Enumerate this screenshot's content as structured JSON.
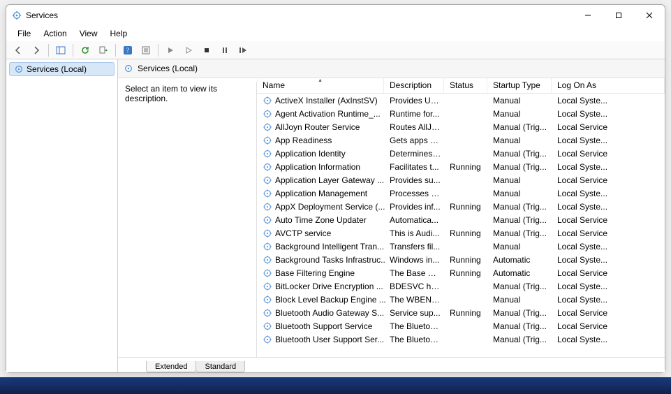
{
  "window": {
    "title": "Services"
  },
  "menubar": {
    "file": "File",
    "action": "Action",
    "view": "View",
    "help": "Help"
  },
  "nav": {
    "item0": "Services (Local)"
  },
  "content_header": {
    "title": "Services (Local)"
  },
  "detail": {
    "prompt": "Select an item to view its description."
  },
  "columns": {
    "name": "Name",
    "description": "Description",
    "status": "Status",
    "startup": "Startup Type",
    "logon": "Log On As"
  },
  "tabs": {
    "extended": "Extended",
    "standard": "Standard"
  },
  "rows": [
    {
      "name": "ActiveX Installer (AxInstSV)",
      "desc": "Provides Us...",
      "status": "",
      "startup": "Manual",
      "logon": "Local Syste..."
    },
    {
      "name": "Agent Activation Runtime_...",
      "desc": "Runtime for...",
      "status": "",
      "startup": "Manual",
      "logon": "Local Syste..."
    },
    {
      "name": "AllJoyn Router Service",
      "desc": "Routes AllJo...",
      "status": "",
      "startup": "Manual (Trig...",
      "logon": "Local Service"
    },
    {
      "name": "App Readiness",
      "desc": "Gets apps re...",
      "status": "",
      "startup": "Manual",
      "logon": "Local Syste..."
    },
    {
      "name": "Application Identity",
      "desc": "Determines ...",
      "status": "",
      "startup": "Manual (Trig...",
      "logon": "Local Service"
    },
    {
      "name": "Application Information",
      "desc": "Facilitates t...",
      "status": "Running",
      "startup": "Manual (Trig...",
      "logon": "Local Syste..."
    },
    {
      "name": "Application Layer Gateway ...",
      "desc": "Provides su...",
      "status": "",
      "startup": "Manual",
      "logon": "Local Service"
    },
    {
      "name": "Application Management",
      "desc": "Processes in...",
      "status": "",
      "startup": "Manual",
      "logon": "Local Syste..."
    },
    {
      "name": "AppX Deployment Service (...",
      "desc": "Provides inf...",
      "status": "Running",
      "startup": "Manual (Trig...",
      "logon": "Local Syste..."
    },
    {
      "name": "Auto Time Zone Updater",
      "desc": "Automatica...",
      "status": "",
      "startup": "Manual (Trig...",
      "logon": "Local Service"
    },
    {
      "name": "AVCTP service",
      "desc": "This is Audi...",
      "status": "Running",
      "startup": "Manual (Trig...",
      "logon": "Local Service"
    },
    {
      "name": "Background Intelligent Tran...",
      "desc": "Transfers fil...",
      "status": "",
      "startup": "Manual",
      "logon": "Local Syste..."
    },
    {
      "name": "Background Tasks Infrastruc...",
      "desc": "Windows in...",
      "status": "Running",
      "startup": "Automatic",
      "logon": "Local Syste..."
    },
    {
      "name": "Base Filtering Engine",
      "desc": "The Base Fil...",
      "status": "Running",
      "startup": "Automatic",
      "logon": "Local Service"
    },
    {
      "name": "BitLocker Drive Encryption ...",
      "desc": "BDESVC hos...",
      "status": "",
      "startup": "Manual (Trig...",
      "logon": "Local Syste..."
    },
    {
      "name": "Block Level Backup Engine ...",
      "desc": "The WBENG...",
      "status": "",
      "startup": "Manual",
      "logon": "Local Syste..."
    },
    {
      "name": "Bluetooth Audio Gateway S...",
      "desc": "Service sup...",
      "status": "Running",
      "startup": "Manual (Trig...",
      "logon": "Local Service"
    },
    {
      "name": "Bluetooth Support Service",
      "desc": "The Bluetoo...",
      "status": "",
      "startup": "Manual (Trig...",
      "logon": "Local Service"
    },
    {
      "name": "Bluetooth User Support Ser...",
      "desc": "The Bluetoo...",
      "status": "",
      "startup": "Manual (Trig...",
      "logon": "Local Syste..."
    }
  ]
}
